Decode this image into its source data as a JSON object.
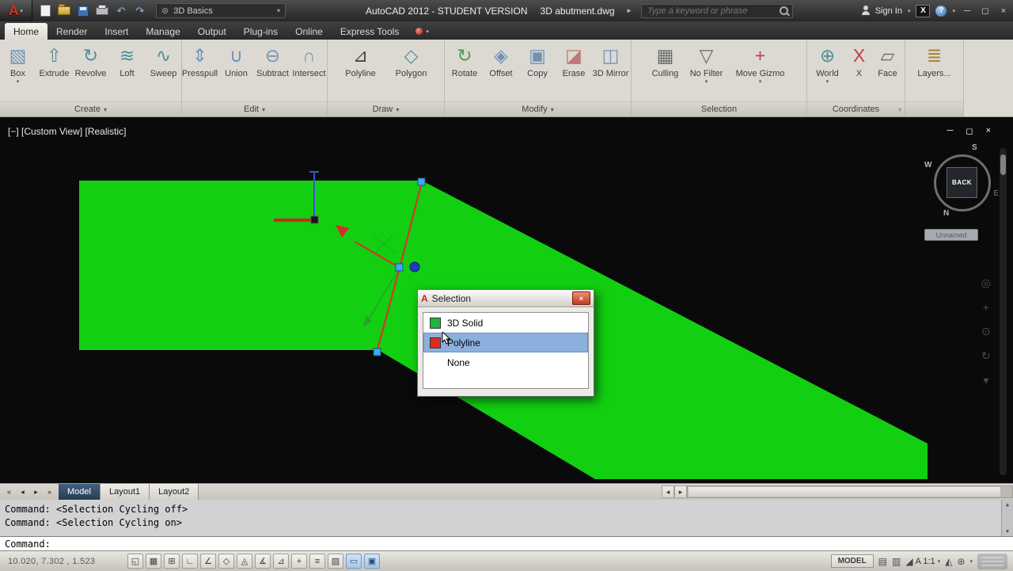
{
  "titlebar": {
    "logo_letter": "A",
    "logo_arrow": "▾",
    "undo_glyph": "↶",
    "redo_glyph": "↷",
    "workspace": {
      "icon": "⊛",
      "value": "3D Basics",
      "arrow": "▾"
    },
    "title_app": "AutoCAD 2012 - STUDENT VERSION",
    "title_doc": "3D abutment.dwg",
    "title_arrow": "▸",
    "search_placeholder": "Type a keyword or phrase",
    "sign_in": "Sign In",
    "signin_arrow": "▾",
    "exchange": "X",
    "help": "?",
    "help_arrow": "▾",
    "win_min": "─",
    "win_restore": "◻",
    "win_close": "×"
  },
  "ribbon": {
    "tabs": [
      "Home",
      "Render",
      "Insert",
      "Manage",
      "Output",
      "Plug-ins",
      "Online",
      "Express Tools"
    ],
    "overflow_arrow": "▾",
    "panels": [
      {
        "label": "Create",
        "arrow": "▾",
        "buttons": [
          {
            "label": "Box",
            "glyph": "▧",
            "arrow": "▾"
          },
          {
            "label": "Extrude",
            "glyph": "⇧"
          },
          {
            "label": "Revolve",
            "glyph": "↻"
          },
          {
            "label": "Loft",
            "glyph": "≋"
          },
          {
            "label": "Sweep",
            "glyph": "∿"
          }
        ]
      },
      {
        "label": "Edit",
        "arrow": "▾",
        "buttons": [
          {
            "label": "Presspull",
            "glyph": "⇕"
          },
          {
            "label": "Union",
            "glyph": "∪"
          },
          {
            "label": "Subtract",
            "glyph": "⊖"
          },
          {
            "label": "Intersect",
            "glyph": "∩"
          }
        ]
      },
      {
        "label": "Draw",
        "arrow": "▾",
        "buttons": [
          {
            "label": "Polyline",
            "glyph": "⊿"
          },
          {
            "label": "Polygon",
            "glyph": "◇"
          }
        ]
      },
      {
        "label": "Modify",
        "arrow": "▾",
        "buttons": [
          {
            "label": "Rotate",
            "glyph": "↻"
          },
          {
            "label": "Offset",
            "glyph": "◈"
          },
          {
            "label": "Copy",
            "glyph": "▣"
          },
          {
            "label": "Erase",
            "glyph": "◪"
          },
          {
            "label": "3D Mirror",
            "glyph": "◫"
          }
        ]
      },
      {
        "label": "Selection",
        "arrow": "",
        "buttons": [
          {
            "label": "Culling",
            "glyph": "▦"
          },
          {
            "label": "No Filter",
            "glyph": "▽",
            "arrow": "▾"
          },
          {
            "label": "Move Gizmo",
            "glyph": "+",
            "arrow": "▾"
          }
        ]
      },
      {
        "label": "Coordinates",
        "arrow": "▿",
        "buttons": [
          {
            "label": "World",
            "glyph": "⊕",
            "arrow": "▾"
          },
          {
            "label": "X",
            "glyph": "X"
          },
          {
            "label": "Face",
            "glyph": "▱"
          }
        ]
      },
      {
        "label": "",
        "arrow": "",
        "buttons": [
          {
            "label": "Layers...",
            "glyph": "≣"
          }
        ]
      }
    ]
  },
  "viewport": {
    "label": "[−] [Custom View] [Realistic]",
    "win_min": "─",
    "win_restore": "◻",
    "win_close": "×",
    "viewcube": {
      "face": "BACK",
      "n": "N",
      "s": "S",
      "e": "E",
      "w": "W"
    },
    "unnamed": "Unnamed",
    "nav1": "◎",
    "nav2": "+",
    "nav3": "⊙",
    "nav4": "↻",
    "nav5": "▾",
    "colors": {
      "solid_green": "#12cf12",
      "grip_blue": "#3fa9f5",
      "polyline_red": "#e32b2b"
    }
  },
  "dialog": {
    "title": "Selection",
    "close": "×",
    "items": [
      {
        "label": "3D Solid",
        "swatch_style": "background:#22b33a"
      },
      {
        "label": "Polyline",
        "swatch_style": "background:#df2b1f"
      },
      {
        "label": "None",
        "swatch_style": "visibility:hidden"
      }
    ]
  },
  "layoutbar": {
    "nav": [
      "«",
      "◂",
      "▸",
      "»"
    ],
    "tabs": [
      "Model",
      "Layout1",
      "Layout2"
    ],
    "scroll_left": "◂",
    "scroll_right": "▸"
  },
  "command": {
    "lines": [
      "Command: <Selection Cycling off>",
      "Command: <Selection Cycling on>"
    ],
    "prompt": "Command:",
    "scroll_up": "▲",
    "scroll_down": "▼"
  },
  "statusbar": {
    "coords": "10.020, 7.302 , 1.523",
    "toggles": [
      {
        "glyph": "◱"
      },
      {
        "glyph": "▦"
      },
      {
        "glyph": "⊞"
      },
      {
        "glyph": "∟"
      },
      {
        "glyph": "∠"
      },
      {
        "glyph": "◇"
      },
      {
        "glyph": "◬"
      },
      {
        "glyph": "∡"
      },
      {
        "glyph": "⊿"
      },
      {
        "glyph": "+"
      },
      {
        "glyph": "≡"
      },
      {
        "glyph": "▨"
      },
      {
        "glyph": "▭"
      },
      {
        "glyph": "▣"
      }
    ],
    "model": "MODEL",
    "qv_layouts": "▤",
    "qv_drawings": "▥",
    "scale_icon": "◢",
    "scale": "A 1:1",
    "scale_arrow": "▾",
    "ann_visibility": "◭",
    "gear": "⊛",
    "more_arrow": "▾"
  }
}
